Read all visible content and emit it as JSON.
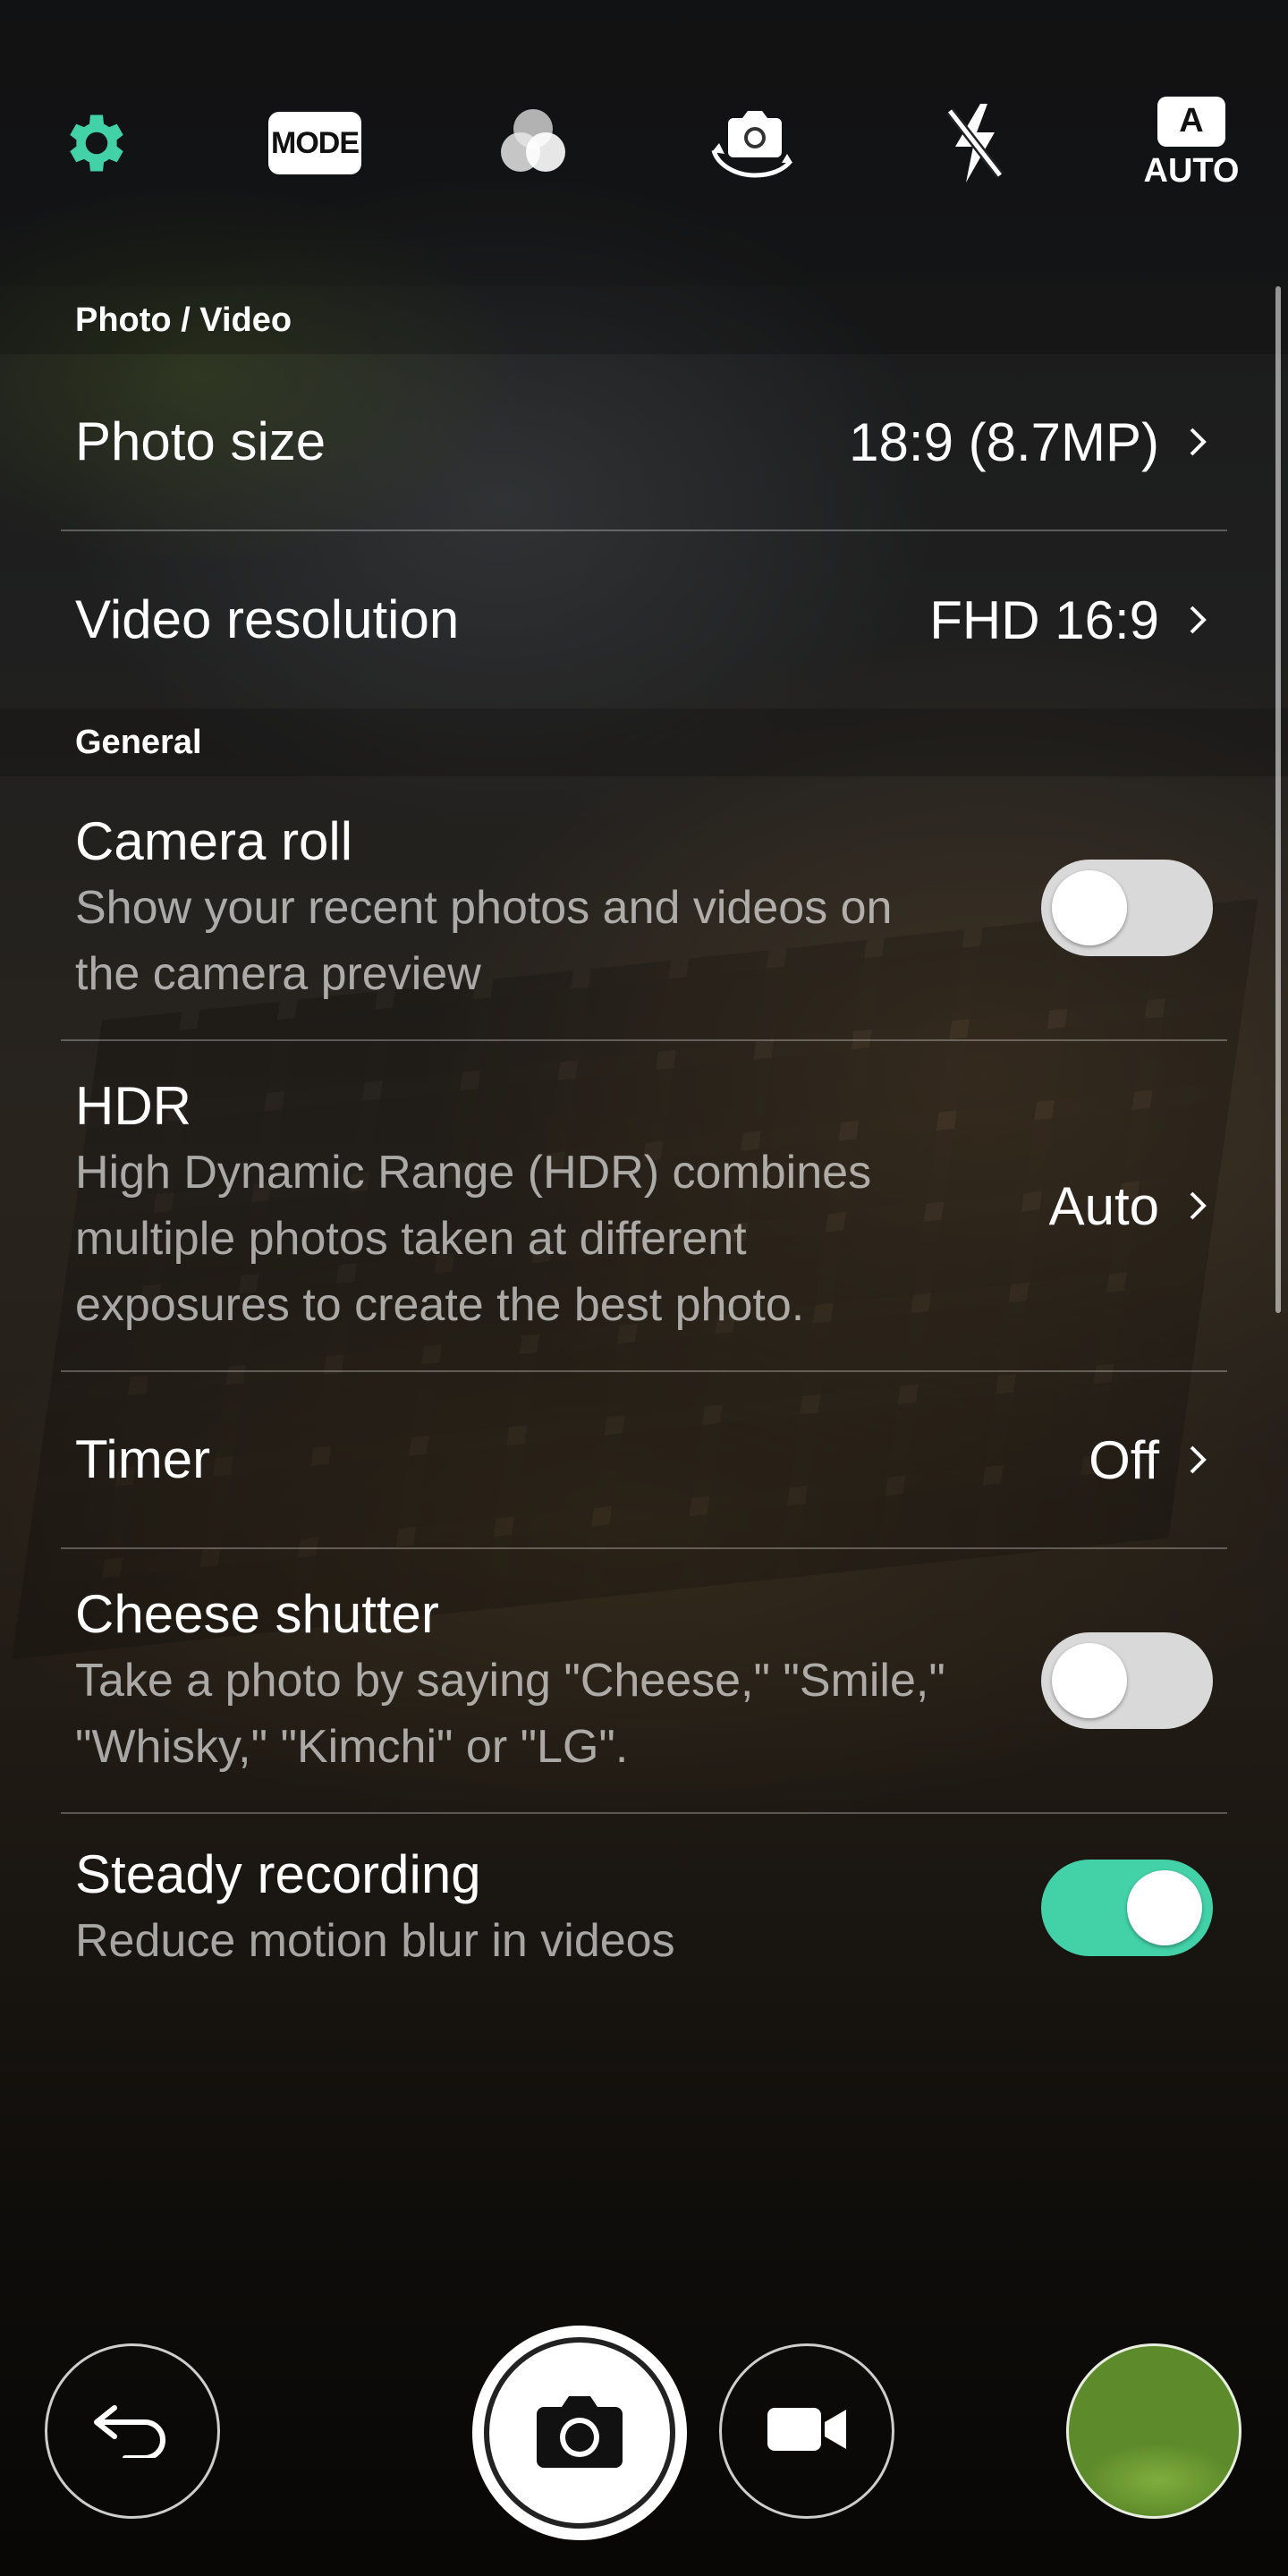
{
  "top_bar": {
    "icons": [
      "settings-gear-icon",
      "mode-icon",
      "filter-icon",
      "switch-camera-icon",
      "flash-off-icon",
      "auto-mode-icon"
    ],
    "mode_label": "MODE",
    "auto_badge": "A",
    "auto_label": "AUTO",
    "accent": "#43d1a8"
  },
  "sections": {
    "photo_video": {
      "header": "Photo / Video",
      "photo_size": {
        "title": "Photo size",
        "value": "18:9 (8.7MP)"
      },
      "video_resolution": {
        "title": "Video resolution",
        "value": "FHD 16:9"
      }
    },
    "general": {
      "header": "General",
      "camera_roll": {
        "title": "Camera roll",
        "desc_line1": "Show your recent photos and videos on",
        "desc_line2": "the camera preview",
        "enabled": false
      },
      "hdr": {
        "title": "HDR",
        "desc_line1": "High Dynamic Range (HDR) combines",
        "desc_line2": "multiple photos taken at different",
        "desc_line3": "exposures to create the best photo.",
        "value": "Auto"
      },
      "timer": {
        "title": "Timer",
        "value": "Off"
      },
      "cheese_shutter": {
        "title": "Cheese shutter",
        "desc_line1": "Take a photo by saying \"Cheese,\" \"Smile,\"",
        "desc_line2": "\"Whisky,\" \"Kimchi\" or \"LG\".",
        "enabled": false
      },
      "steady_recording": {
        "title": "Steady recording",
        "desc": "Reduce motion blur in videos",
        "enabled": true
      }
    }
  },
  "bottom_bar": {
    "icons": [
      "back-arrow-icon",
      "camera-shutter-icon",
      "video-camera-icon",
      "gallery-thumbnail"
    ]
  },
  "colors": {
    "toggle_on": "#43d1a8",
    "toggle_off": "#d9d9d9"
  }
}
